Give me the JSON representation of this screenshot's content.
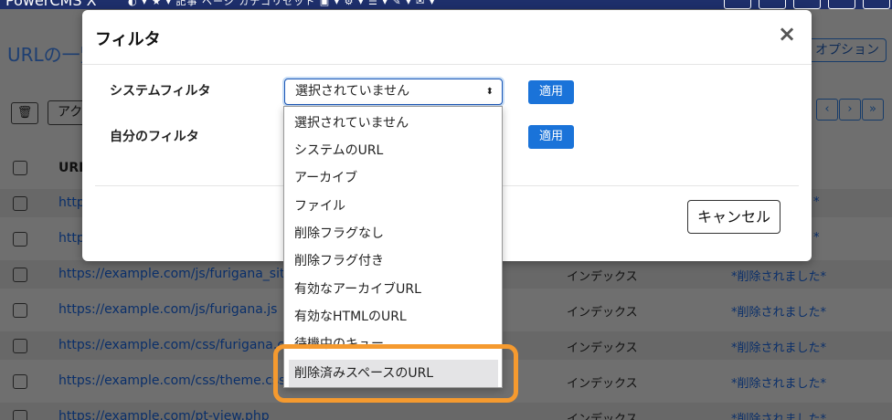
{
  "app": {
    "brand": "PowerCMS X",
    "topnav": "◐ ▾  ★ ▾  記事  ページ  カテゴリセット  ▣ ▾  ⚙ ▾  ☰ ▾  ✎ ▾  ✉ ▾"
  },
  "page": {
    "title": "URLの一覧",
    "options_label": "オプション",
    "action_label": "アクション",
    "trash_icon": "🗑",
    "column_url": "URL",
    "pager_prev": "‹",
    "pager_next": "›",
    "pager_last": "»",
    "rows": [
      {
        "url": "http",
        "type": "",
        "status": "*"
      },
      {
        "url": "http",
        "type": "",
        "status": "*"
      },
      {
        "url": "https://example.com/js/furigana_site",
        "type": "インデックス",
        "status": "*削除されました*"
      },
      {
        "url": "https://example.com/js/furigana.js",
        "type": "インデックス",
        "status": "*削除されました*"
      },
      {
        "url": "https://example.com/css/furigana.cs",
        "type": "インデックス",
        "status": "*削除されました*"
      },
      {
        "url": "https://example.com/css/theme.css",
        "type": "インデックス",
        "status": "*削除されました*"
      },
      {
        "url": "https://example.com/pt-view.php",
        "type": "インデックス",
        "status": "*削除されました*"
      }
    ]
  },
  "modal": {
    "title": "フィルタ",
    "close_icon": "×",
    "system_filter_label": "システムフィルタ",
    "my_filter_label": "自分のフィルタ",
    "apply_label": "適用",
    "select_value": "選択されていません",
    "select_arrow": "⬍",
    "cancel_label": "キャンセル"
  },
  "dropdown": {
    "options": [
      "選択されていません",
      "システムのURL",
      "アーカイブ",
      "ファイル",
      "削除フラグなし",
      "削除フラグ付き",
      "有効なアーカイブURL",
      "有効なHTMLのURL",
      "待機中のキュー",
      "削除済みスペースのURL"
    ],
    "highlighted_index": 9
  },
  "colors": {
    "accent": "#1a73d9",
    "highlight_ring": "#f59a2f",
    "navbar": "#1e2f6b"
  }
}
